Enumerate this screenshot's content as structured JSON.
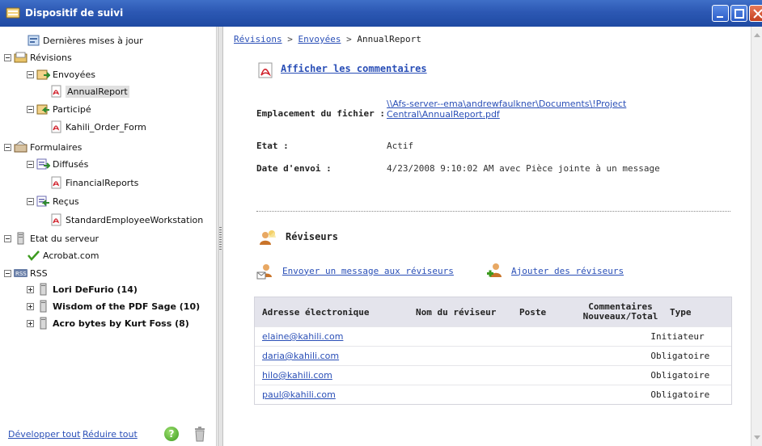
{
  "window": {
    "title": "Dispositif de suivi"
  },
  "tree": {
    "items": [
      {
        "label": "Dernières mises à jour"
      },
      {
        "label": "Révisions"
      },
      {
        "label": "Envoyées"
      },
      {
        "label": "AnnualReport"
      },
      {
        "label": "Participé"
      },
      {
        "label": "Kahili_Order_Form"
      },
      {
        "label": "Formulaires"
      },
      {
        "label": "Diffusés"
      },
      {
        "label": "FinancialReports"
      },
      {
        "label": "Reçus"
      },
      {
        "label": "StandardEmployeeWorkstation"
      },
      {
        "label": "Etat du serveur"
      },
      {
        "label": "Acrobat.com"
      },
      {
        "label": "RSS"
      },
      {
        "label": "Lori DeFurio (14)"
      },
      {
        "label": "Wisdom of the PDF Sage (10)"
      },
      {
        "label": "Acro bytes by Kurt Foss (8)"
      }
    ]
  },
  "footer": {
    "expand_all": "Développer tout",
    "collapse_all": "Réduire tout",
    "help": "?"
  },
  "breadcrumb": {
    "item1": "Révisions",
    "item2": "Envoyées",
    "current": "AnnualReport",
    "sep": ">"
  },
  "details": {
    "view_comments": "Afficher les commentaires",
    "file_location_label": "Emplacement du fichier :",
    "file_location_line1": "\\\\Afs-server--ema\\andrewfaulkner\\Documents\\!Project",
    "file_location_line2": "Central\\AnnualReport.pdf",
    "state_label": "Etat :",
    "state_value": "Actif",
    "sent_date_label": "Date d'envoi :",
    "sent_date_value": "4/23/2008 9:10:02 AM avec Pièce jointe à un message"
  },
  "reviewers": {
    "title": "Réviseurs",
    "send_message": "Envoyer un message aux réviseurs",
    "add_reviewers": "Ajouter des réviseurs",
    "columns": {
      "email": "Adresse électronique",
      "name": "Nom du réviseur",
      "post": "Poste",
      "comments_line1": "Commentaires",
      "comments_line2": "Nouveaux/Total",
      "type": "Type"
    },
    "rows": [
      {
        "email": "elaine@kahili.com",
        "type": "Initiateur"
      },
      {
        "email": "daria@kahili.com",
        "type": "Obligatoire"
      },
      {
        "email": "hilo@kahili.com",
        "type": "Obligatoire"
      },
      {
        "email": "paul@kahili.com",
        "type": "Obligatoire"
      }
    ]
  },
  "colors": {
    "titlebar": "#2c58b3",
    "link": "#2a4fb7",
    "table_header": "#e4e4ec"
  }
}
